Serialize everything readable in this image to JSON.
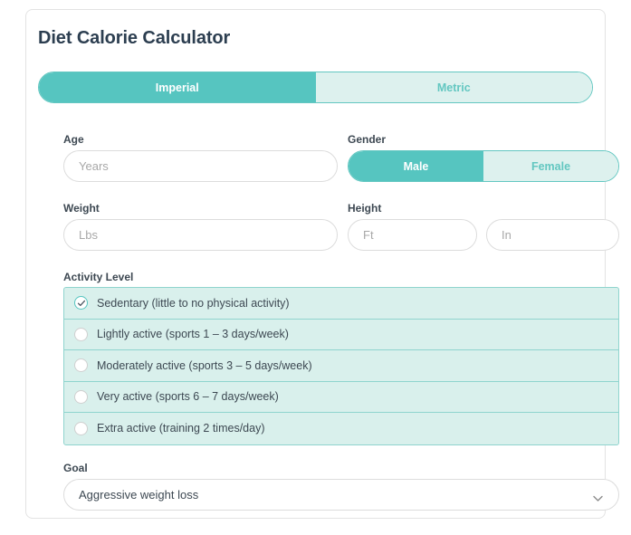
{
  "card": {
    "title": "Diet Calorie Calculator"
  },
  "unit_toggle": {
    "options": [
      {
        "label": "Imperial",
        "active": true
      },
      {
        "label": "Metric",
        "active": false
      }
    ]
  },
  "fields": {
    "age": {
      "label": "Age",
      "placeholder": "Years",
      "value": ""
    },
    "gender": {
      "label": "Gender",
      "options": [
        {
          "label": "Male",
          "active": true
        },
        {
          "label": "Female",
          "active": false
        }
      ]
    },
    "weight": {
      "label": "Weight",
      "placeholder": "Lbs",
      "value": ""
    },
    "height": {
      "label": "Height",
      "feet": {
        "placeholder": "Ft",
        "value": ""
      },
      "inches": {
        "placeholder": "In",
        "value": ""
      }
    }
  },
  "activity": {
    "label": "Activity Level",
    "options": [
      {
        "text": "Sedentary (little to no physical activity)",
        "selected": true
      },
      {
        "text": "Lightly active (sports 1 – 3 days/week)",
        "selected": false
      },
      {
        "text": "Moderately active (sports 3 – 5 days/week)",
        "selected": false
      },
      {
        "text": "Very active (sports 6 – 7 days/week)",
        "selected": false
      },
      {
        "text": "Extra active (training 2 times/day)",
        "selected": false
      }
    ]
  },
  "goal": {
    "label": "Goal",
    "selected": "Aggressive weight loss",
    "icon": "chevron-down-icon"
  },
  "colors": {
    "accent": "#56c5c0",
    "accent_border": "#63c7c1",
    "accent_light": "#ddf1ee",
    "row_bg": "#d9f0ec",
    "row_border": "#8fd4ce",
    "text": "#3d4852",
    "title": "#2c3e50"
  }
}
